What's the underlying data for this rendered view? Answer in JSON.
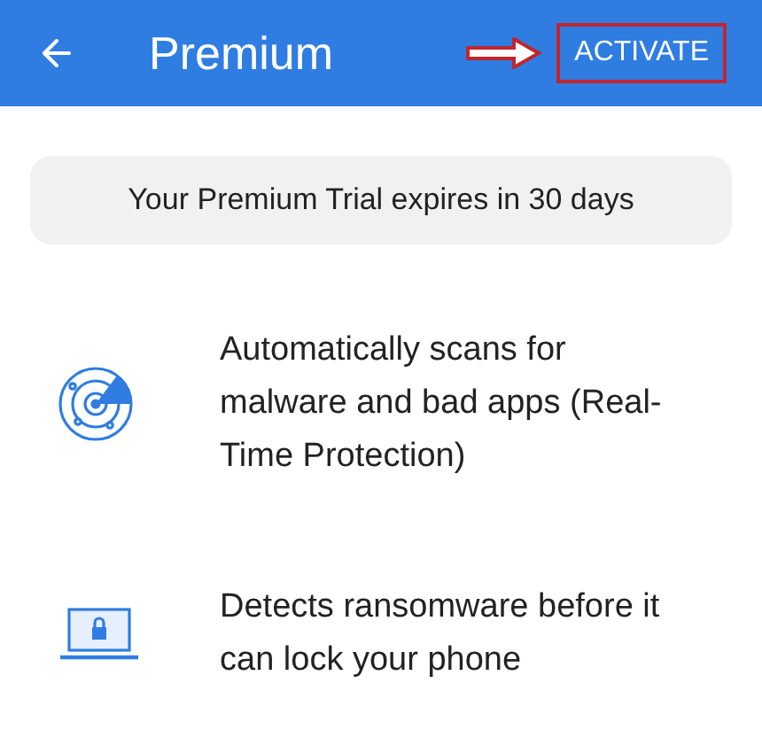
{
  "header": {
    "title": "Premium",
    "action": "ACTIVATE"
  },
  "banner": "Your Premium Trial expires in 30 days",
  "features": [
    {
      "kind": "radar",
      "text": "Automatically scans for malware and bad apps (Real-Time Protection)"
    },
    {
      "kind": "laptop",
      "text": "Detects ransomware before it can lock your phone"
    }
  ]
}
